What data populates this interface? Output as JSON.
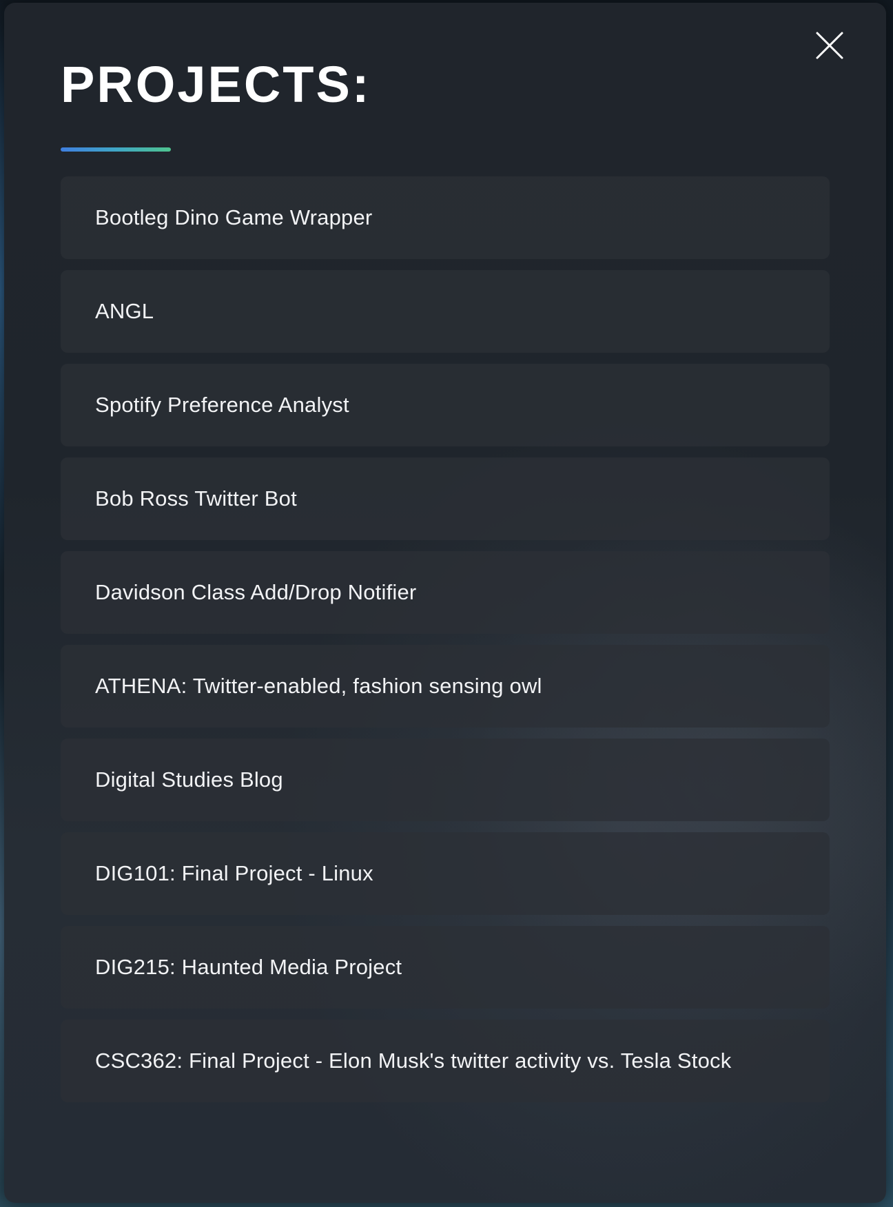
{
  "modal": {
    "title": "PROJECTS:",
    "close_icon": "close-icon",
    "accent_gradient": [
      "#3f7fe0",
      "#4fc48f"
    ]
  },
  "projects": [
    {
      "label": "Bootleg Dino Game Wrapper"
    },
    {
      "label": "ANGL"
    },
    {
      "label": "Spotify Preference Analyst"
    },
    {
      "label": "Bob Ross Twitter Bot"
    },
    {
      "label": "Davidson Class Add/Drop Notifier"
    },
    {
      "label": "ATHENA: Twitter-enabled, fashion sensing owl"
    },
    {
      "label": "Digital Studies Blog"
    },
    {
      "label": "DIG101: Final Project - Linux"
    },
    {
      "label": "DIG215: Haunted Media Project"
    },
    {
      "label": "CSC362: Final Project - Elon Musk's twitter activity vs. Tesla Stock"
    }
  ]
}
